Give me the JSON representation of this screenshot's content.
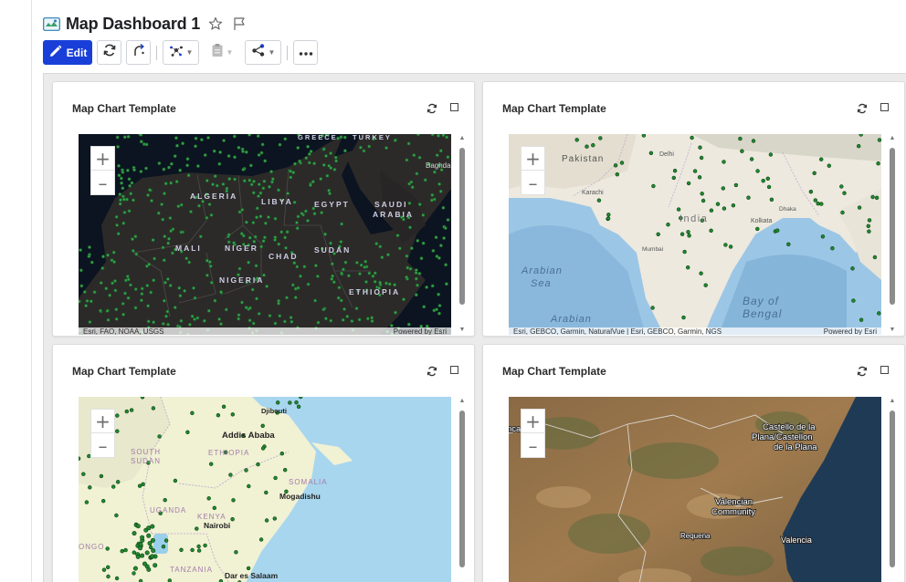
{
  "dashboard": {
    "title": "Map Dashboard 1",
    "icon": "map-dashboard-icon"
  },
  "toolbar": {
    "edit_label": "Edit",
    "buttons": [
      "refresh-icon",
      "share-link-icon",
      "network-icon",
      "clipboard-icon",
      "share-icon",
      "more-icon"
    ]
  },
  "panels": [
    {
      "title": "Map Chart Template",
      "basemap": "dark-gray",
      "attribution_left": "Esri, FAO, NOAA, USGS",
      "attribution_right": "Powered by Esri",
      "labels": [
        "GREECE",
        "TURKEY",
        "Baghdad",
        "ALGERIA",
        "LIBYA",
        "EGYPT",
        "SAUDI",
        "ARABIA",
        "MALI",
        "NIGER",
        "CHAD",
        "SUDAN",
        "NIGERIA",
        "ETHIOPIA"
      ]
    },
    {
      "title": "Map Chart Template",
      "basemap": "topographic",
      "attribution_left": "Esri, GEBCO, Garmin, NaturalVue | Esri, GEBCO, Garmin, NGS",
      "attribution_right": "Powered by Esri",
      "labels": [
        "Pakistan",
        "Delhi",
        "Karachi",
        "India",
        "Kolkata",
        "Mumbai",
        "Arabian",
        "Sea",
        "Arabian",
        "Bay of",
        "Bengal",
        "Dhaka"
      ]
    },
    {
      "title": "Map Chart Template",
      "basemap": "streets",
      "labels": [
        "Djibouti",
        "Addis Ababa",
        "ETHIOPIA",
        "SOUTH",
        "SUDAN",
        "SOMALIA",
        "Mogadishu",
        "UGANDA",
        "KENYA",
        "Nairobi",
        "ONGO",
        "TANZANIA",
        "Dar es Salaam"
      ]
    },
    {
      "title": "Map Chart Template",
      "basemap": "imagery",
      "labels": [
        "nca",
        "Castello de la",
        "Plana/Castellon",
        "de la Plana",
        "Valencian",
        "Community",
        "Requena",
        "Valencia"
      ]
    }
  ],
  "colors": {
    "edit_button": "#1a3fd8",
    "marker": "#1f8a2e",
    "marker_dark_outline": "#0b3d12"
  }
}
